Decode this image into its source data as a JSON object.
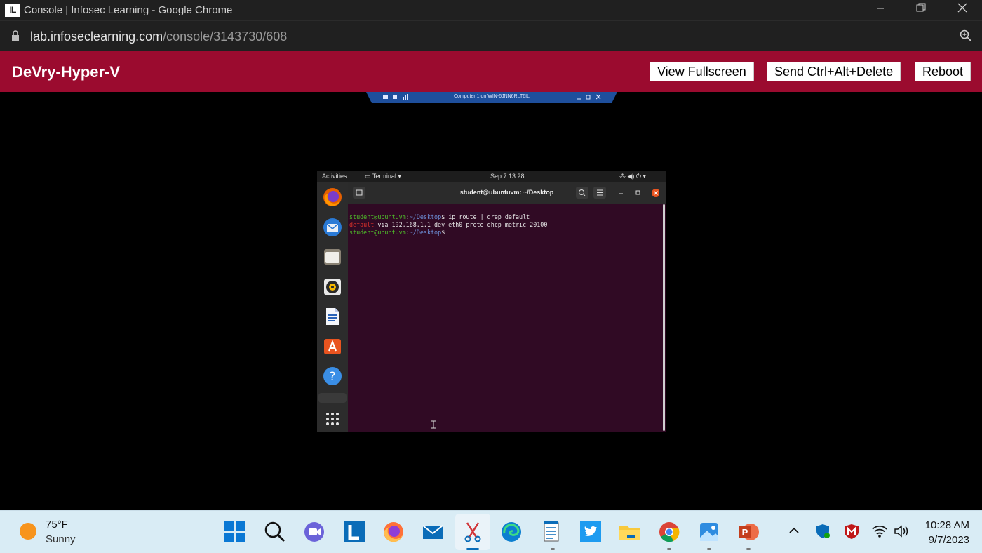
{
  "browser": {
    "window_title": "Console | Infosec Learning - Google Chrome",
    "logo_text": "IL",
    "url_host": "lab.infoseclearning.com",
    "url_path": "/console/3143730/608"
  },
  "lab": {
    "title": "DeVry-Hyper-V",
    "buttons": {
      "fullscreen": "View Fullscreen",
      "ctrl_alt_del": "Send Ctrl+Alt+Delete",
      "reboot": "Reboot"
    }
  },
  "hyperv": {
    "title": "Computer 1 on WIN-6JNN6RLT6IL"
  },
  "vm": {
    "topbar": {
      "activities": "Activities",
      "app": "Terminal",
      "datetime": "Sep 7  13:28"
    },
    "terminal": {
      "title": "student@ubuntuvm: ~/Desktop",
      "prompt_user": "student@ubuntuvm",
      "prompt_sep": ":",
      "prompt_path": "~/Desktop",
      "prompt_end": "$",
      "command": " ip route | grep default",
      "out_default": "default",
      "out_rest": " via 192.168.1.1 dev eth0 proto dhcp metric 20100"
    },
    "dock": [
      "firefox-icon",
      "thunderbird-icon",
      "files-icon",
      "rhythmbox-icon",
      "writer-icon",
      "software-icon",
      "help-icon"
    ]
  },
  "taskbar": {
    "weather_temp": "75°F",
    "weather_cond": "Sunny",
    "time": "10:28 AM",
    "date": "9/7/2023"
  },
  "colors": {
    "lab_accent": "#9b0b2f",
    "terminal_bg": "#300a24",
    "taskbar_bg": "#d9ecf5"
  }
}
